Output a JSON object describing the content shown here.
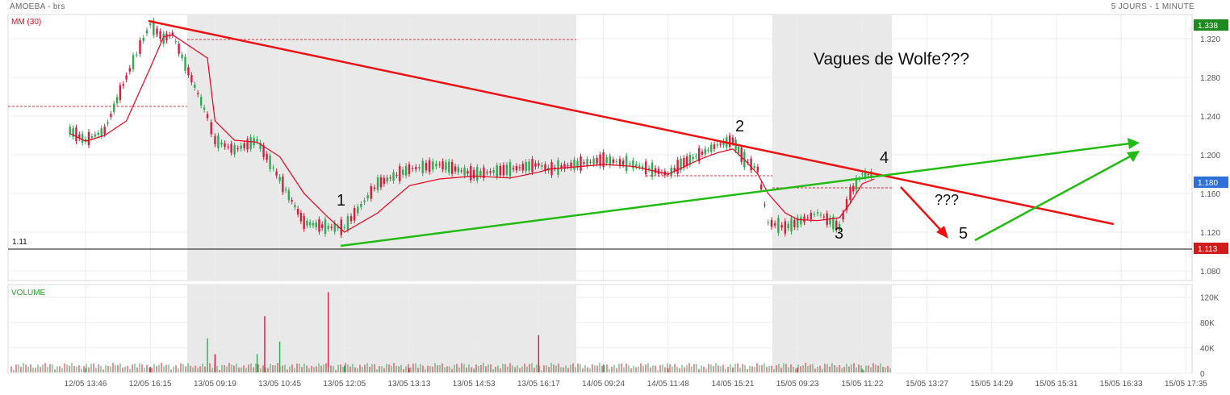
{
  "header": {
    "title": "AMOEBA - brs",
    "period": "5 JOURS - 1 MINUTE"
  },
  "indicators": {
    "moving_average_label": "MM (30)",
    "volume_label": "VOLUME",
    "support_level_label": "1.11",
    "colors": {
      "up": "#34a853",
      "down": "#d61e3a",
      "moving_average": "#e8001c",
      "annotation_resistance": "#ee1111",
      "annotation_support": "#22bb11"
    }
  },
  "annotations": {
    "title_text": "Vagues de Wolfe???",
    "wave_labels": [
      "1",
      "2",
      "3",
      "4",
      "5"
    ],
    "question_text": "???"
  },
  "price_tags": {
    "high": "1.338",
    "current": "1.180",
    "low": "1.113"
  },
  "chart_data": [
    {
      "type": "line",
      "title": "AMOEBA - brs",
      "series": [
        {
          "name": "MM (30)",
          "x": [
            "12/05 13:10",
            "12/05 13:46",
            "12/05 14:30",
            "12/05 15:20",
            "12/05 16:15",
            "12/05 17:00",
            "12/05 17:30",
            "13/05 09:05",
            "13/05 09:19",
            "13/05 09:45",
            "13/05 10:15",
            "13/05 10:45",
            "13/05 11:15",
            "13/05 11:45",
            "13/05 12:05",
            "13/05 12:40",
            "13/05 13:13",
            "13/05 14:00",
            "13/05 14:53",
            "13/05 15:40",
            "13/05 16:17",
            "13/05 16:50",
            "14/05 09:24",
            "14/05 10:30",
            "14/05 11:48",
            "14/05 12:30",
            "14/05 13:30",
            "14/05 14:30",
            "14/05 15:21",
            "14/05 16:00",
            "14/05 16:45",
            "14/05 17:20",
            "15/05 09:00",
            "15/05 09:23",
            "15/05 10:00",
            "15/05 10:40",
            "15/05 11:00",
            "15/05 11:22",
            "15/05 11:45"
          ],
          "values": [
            1.222,
            1.214,
            1.22,
            1.235,
            1.29,
            1.322,
            1.324,
            1.3,
            1.235,
            1.215,
            1.213,
            1.198,
            1.16,
            1.135,
            1.12,
            1.14,
            1.168,
            1.175,
            1.178,
            1.176,
            1.182,
            1.185,
            1.19,
            1.188,
            1.18,
            1.186,
            1.195,
            1.202,
            1.206,
            1.195,
            1.18,
            1.16,
            1.14,
            1.133,
            1.132,
            1.135,
            1.15,
            1.17,
            1.175
          ]
        },
        {
          "name": "AMOEBA - brs",
          "x": [
            "12/05 13:10",
            "12/05 13:46",
            "12/05 14:30",
            "12/05 15:20",
            "12/05 16:15",
            "12/05 17:00",
            "12/05 17:30",
            "13/05 09:05",
            "13/05 09:19",
            "13/05 09:45",
            "13/05 10:15",
            "13/05 10:45",
            "13/05 11:15",
            "13/05 11:45",
            "13/05 12:05",
            "13/05 12:40",
            "13/05 13:13",
            "13/05 14:00",
            "13/05 14:53",
            "13/05 15:40",
            "13/05 16:17",
            "13/05 16:50",
            "14/05 09:24",
            "14/05 10:30",
            "14/05 11:48",
            "14/05 12:30",
            "14/05 13:30",
            "14/05 14:30",
            "14/05 15:21",
            "14/05 16:00",
            "14/05 16:45",
            "14/05 17:20",
            "15/05 09:00",
            "15/05 09:23",
            "15/05 10:00",
            "15/05 10:40",
            "15/05 11:00",
            "15/05 11:22",
            "15/05 11:45"
          ],
          "values": [
            1.225,
            1.215,
            1.225,
            1.28,
            1.335,
            1.32,
            1.325,
            1.24,
            1.215,
            1.205,
            1.215,
            1.175,
            1.13,
            1.125,
            1.125,
            1.17,
            1.185,
            1.19,
            1.18,
            1.185,
            1.19,
            1.185,
            1.195,
            1.19,
            1.18,
            1.19,
            1.2,
            1.21,
            1.215,
            1.195,
            1.185,
            1.13,
            1.125,
            1.13,
            1.14,
            1.125,
            1.16,
            1.18,
            1.18
          ]
        }
      ],
      "xlabel": "",
      "ylabel": "",
      "y_ticks": [
        "1.320",
        "1.280",
        "1.240",
        "1.200",
        "1.160",
        "1.120",
        "1.080"
      ],
      "x_ticks": [
        "12/05 13:46",
        "12/05 16:15",
        "13/05 09:19",
        "13/05 10:45",
        "13/05 12:05",
        "13/05 13:13",
        "13/05 14:53",
        "13/05 16:17",
        "14/05 09:24",
        "14/05 11:48",
        "14/05 15:21",
        "15/05 09:23",
        "15/05 11:22",
        "15/05 13:27",
        "15/05 14:29",
        "15/05 15:31",
        "15/05 16:33",
        "15/05 17:35"
      ],
      "ylim": [
        1.07,
        1.345
      ],
      "reference_lines": [
        {
          "label": "1.11",
          "value": 1.11
        }
      ],
      "grid": true,
      "legend": "top-left"
    },
    {
      "type": "bar",
      "title": "VOLUME",
      "y_ticks": [
        "120K",
        "80K",
        "40K",
        "0"
      ],
      "ylim": [
        0,
        140000
      ],
      "x": [
        "12/05 13:46",
        "12/05 16:15",
        "13/05 09:05",
        "13/05 09:19",
        "13/05 10:15",
        "13/05 10:25",
        "13/05 10:45",
        "13/05 11:45",
        "13/05 12:05",
        "13/05 13:13",
        "13/05 14:53",
        "13/05 16:17",
        "14/05 09:24",
        "14/05 11:48",
        "14/05 15:21",
        "15/05 09:23",
        "15/05 11:22"
      ],
      "values": [
        8000,
        10000,
        55000,
        30000,
        30000,
        90000,
        50000,
        128000,
        12000,
        8000,
        6000,
        60000,
        14000,
        8000,
        8000,
        9000,
        7000
      ],
      "grid": true
    }
  ]
}
